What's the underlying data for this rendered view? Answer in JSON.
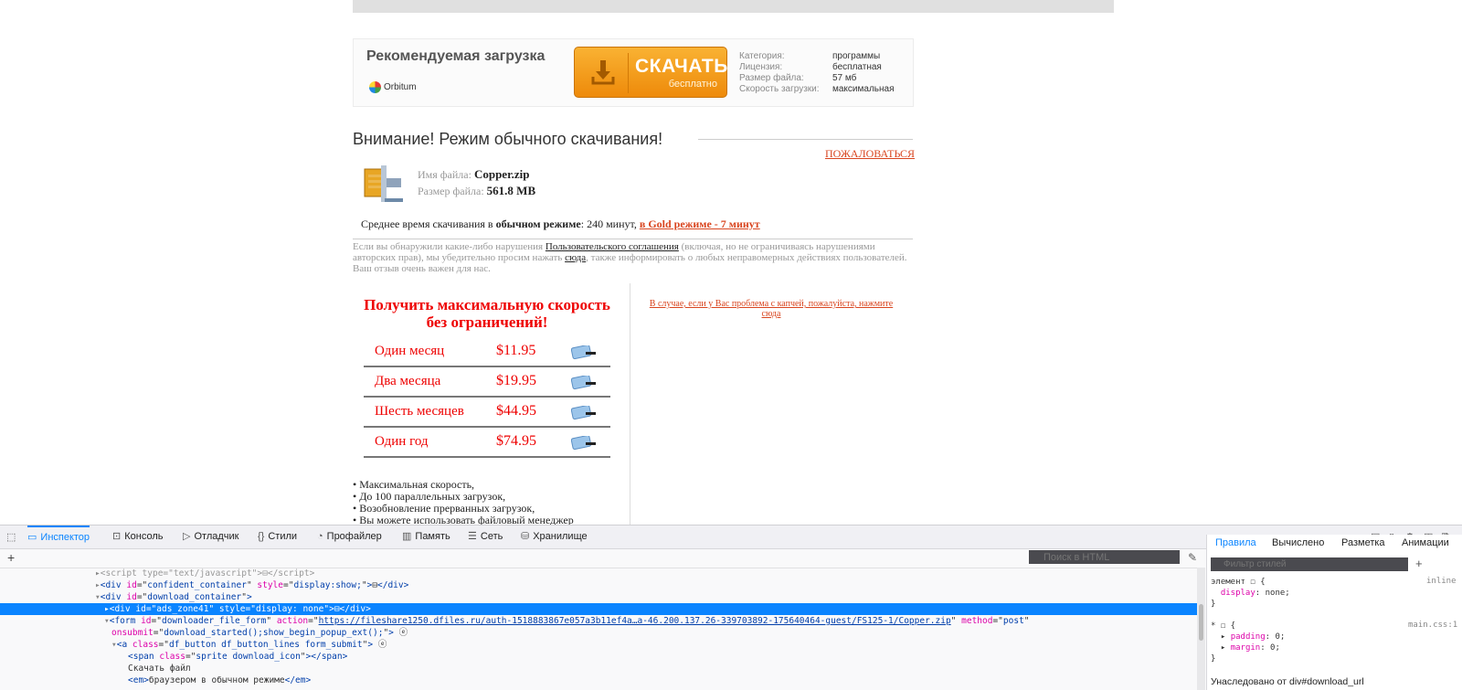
{
  "page": {
    "rec_title": "Рекомендуемая загрузка",
    "brand": "Orbitum",
    "download_big": "СКАЧАТЬ",
    "download_small": "бесплатно",
    "meta": [
      {
        "k": "Категория:",
        "v": "программы"
      },
      {
        "k": "Лицензия:",
        "v": "бесплатная"
      },
      {
        "k": "Размер файла:",
        "v": "57 мб"
      },
      {
        "k": "Скорость загрузки:",
        "v": "максимальная"
      }
    ],
    "attention": "Внимание! Режим обычного скачивания!",
    "complain": "ПОЖАЛОВАТЬСЯ",
    "file_name_label": "Имя файла:",
    "file_name": "Copper.zip",
    "file_size_label": "Размер файла:",
    "file_size": "561.8 MB",
    "avg_prefix": "Среднее время скачивания в ",
    "avg_mode": "обычном режиме",
    "avg_suffix": ": 240 минут, ",
    "gold_link": "в Gold режиме - 7 минут",
    "notice_1": "Если вы обнаружили какие-либо нарушения ",
    "notice_link1": "Пользовательского соглашения",
    "notice_2": " (включая, но не ограничиваясь нарушениями авторских прав), мы убедительно просим нажать ",
    "notice_link2": "сюда",
    "notice_3": ", также информировать о любых неправомерных действиях пользователей. Ваш отзыв очень важен для нас.",
    "promo": "Получить максимальную скорость без ограничений!",
    "prices": [
      {
        "name": "Один месяц",
        "price": "$11.95"
      },
      {
        "name": "Два месяца",
        "price": "$19.95"
      },
      {
        "name": "Шесть месяцев",
        "price": "$44.95"
      },
      {
        "name": "Один год",
        "price": "$74.95"
      }
    ],
    "captcha": "В случае, если у Вас проблема с капчей, пожалуйста, нажмите сюда",
    "features": [
      "Максимальная скорость,",
      "До 100 параллельных загрузок,",
      "Возобновление прерванных загрузок,",
      "Вы можете использовать файловый менеджер"
    ]
  },
  "devtools": {
    "tabs": [
      {
        "label": "Инспектор",
        "icon": "inspector-icon",
        "active": true
      },
      {
        "label": "Консоль",
        "icon": "console-icon"
      },
      {
        "label": "Отладчик",
        "icon": "debugger-icon"
      },
      {
        "label": "Стили",
        "icon": "style-editor-icon"
      },
      {
        "label": "Профайлер",
        "icon": "performance-icon"
      },
      {
        "label": "Память",
        "icon": "memory-icon"
      },
      {
        "label": "Сеть",
        "icon": "network-icon"
      },
      {
        "label": "Хранилище",
        "icon": "storage-icon"
      }
    ],
    "html_search_placeholder": "Поиск в HTML",
    "markup": {
      "l1_tag": "script",
      "l1_attr": "type",
      "l1_val": "text/javascript",
      "l2_id": "confident_container",
      "l2_style": "display:show;",
      "l3_id": "download_container",
      "l4_id": "ads_zone41",
      "l4_style": "display: none",
      "l5_id": "downloader_file_form",
      "l5_action": "https://fileshare1250.dfiles.ru/auth-1518883867e057a3b11ef4a…a-46.200.137.26-339703892-175640464-guest/FS125-1/Copper.zip",
      "l5_method": "post",
      "l6_onsubmit": "download_started();show_begin_popup_ext();",
      "l7_class": "df_button df_button_lines form_submit",
      "l8_class": "sprite download_icon",
      "l9_text": "Скачать файл",
      "l10_text": "браузером в обычном режиме"
    },
    "side_tabs": [
      "Правила",
      "Вычислено",
      "Разметка",
      "Анимации"
    ],
    "filter_placeholder": "Фильтр стилей",
    "rule1_selector": "элемент",
    "rule1_source": "inline",
    "rule1_prop": "display",
    "rule1_val": "none;",
    "rule2_selector": "*",
    "rule2_source": "main.css:1",
    "rule2_p1": "padding",
    "rule2_v1": "0;",
    "rule2_p2": "margin",
    "rule2_v2": "0;",
    "inherited": "Унаследовано от div#download_url"
  },
  "colors": {
    "accent": "#0a84ff",
    "link_red": "#d9451f",
    "promo_red": "#e00",
    "button_orange": "#f39c1b"
  }
}
